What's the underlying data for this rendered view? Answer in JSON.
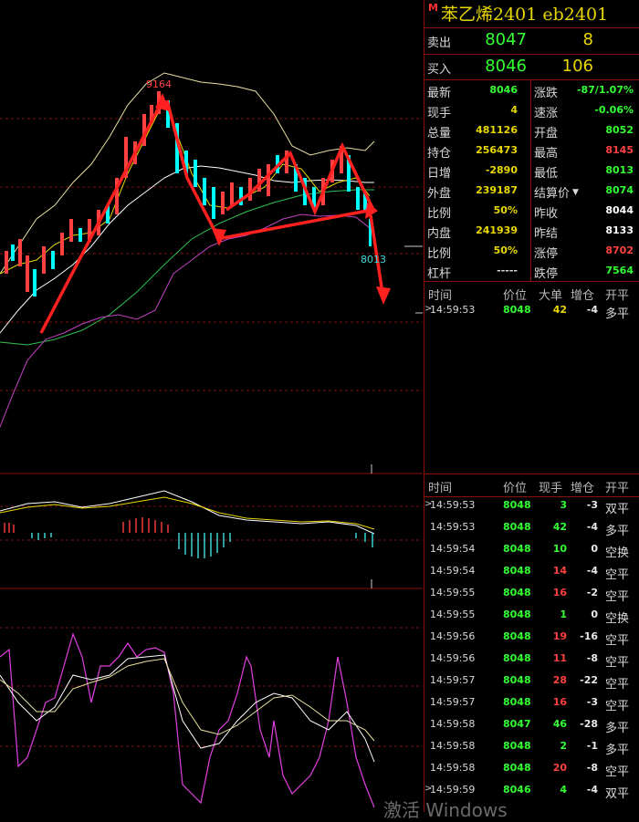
{
  "header": {
    "mark": "M",
    "title": "苯乙烯2401  eb2401"
  },
  "orderbook": {
    "ask": {
      "label": "卖出",
      "price": "8047",
      "volume": "8"
    },
    "bid": {
      "label": "买入",
      "price": "8046",
      "volume": "106"
    }
  },
  "stats_left": [
    {
      "label": "最新",
      "value": "8046",
      "color": "#33ff33"
    },
    {
      "label": "现手",
      "value": "4",
      "color": "#e8d800"
    },
    {
      "label": "总量",
      "value": "481126",
      "color": "#e8d800"
    },
    {
      "label": "持仓",
      "value": "256473",
      "color": "#e8d800"
    },
    {
      "label": "日增",
      "value": "-2890",
      "color": "#e8d800"
    },
    {
      "label": "外盘",
      "value": "239187",
      "color": "#e8d800"
    },
    {
      "label": "比例",
      "value": "50%",
      "color": "#e8d800"
    },
    {
      "label": "内盘",
      "value": "241939",
      "color": "#e8d800"
    },
    {
      "label": "比例",
      "value": "50%",
      "color": "#e8d800"
    },
    {
      "label": "杠杆",
      "value": "-----",
      "color": "#d8d8d8"
    }
  ],
  "stats_right": [
    {
      "label": "涨跌",
      "value": "-87/1.07%",
      "color": "#33ff33"
    },
    {
      "label": "速涨",
      "value": "-0.06%",
      "color": "#33ff33"
    },
    {
      "label": "开盘",
      "value": "8052",
      "color": "#33ff33"
    },
    {
      "label": "最高",
      "value": "8145",
      "color": "#ff4040"
    },
    {
      "label": "最低",
      "value": "8013",
      "color": "#33ff33"
    },
    {
      "label": "结算价",
      "value": "8074",
      "color": "#33ff33"
    },
    {
      "label": "昨收",
      "value": "8044",
      "color": "#ffffff"
    },
    {
      "label": "昨结",
      "value": "8133",
      "color": "#ffffff"
    },
    {
      "label": "涨停",
      "value": "8702",
      "color": "#ff4040"
    },
    {
      "label": "跌停",
      "value": "7564",
      "color": "#33ff33"
    }
  ],
  "big_orders": {
    "headers": [
      "时间",
      "价位",
      "大单",
      "增仓",
      "开平"
    ],
    "rows": [
      {
        "time": "14:59:53",
        "price": "8048",
        "vol": "42",
        "chg": "-4",
        "nature": "多平",
        "vol_color": "#e8d800"
      }
    ]
  },
  "ticks": {
    "headers": [
      "时间",
      "价位",
      "现手",
      "增仓",
      "开平"
    ],
    "rows": [
      {
        "time": "14:59:53",
        "price": "8048",
        "vol": "3",
        "chg": "-3",
        "nature": "双平",
        "vol_color": "#33ff33"
      },
      {
        "time": "14:59:53",
        "price": "8048",
        "vol": "42",
        "chg": "-4",
        "nature": "多平",
        "vol_color": "#33ff33"
      },
      {
        "time": "14:59:54",
        "price": "8048",
        "vol": "10",
        "chg": "0",
        "nature": "空换",
        "vol_color": "#33ff33"
      },
      {
        "time": "14:59:54",
        "price": "8048",
        "vol": "14",
        "chg": "-4",
        "nature": "空平",
        "vol_color": "#ff4040"
      },
      {
        "time": "14:59:55",
        "price": "8048",
        "vol": "16",
        "chg": "-2",
        "nature": "空平",
        "vol_color": "#ff4040"
      },
      {
        "time": "14:59:55",
        "price": "8048",
        "vol": "1",
        "chg": "0",
        "nature": "空换",
        "vol_color": "#33ff33"
      },
      {
        "time": "14:59:56",
        "price": "8048",
        "vol": "19",
        "chg": "-16",
        "nature": "空平",
        "vol_color": "#ff4040"
      },
      {
        "time": "14:59:56",
        "price": "8048",
        "vol": "11",
        "chg": "-8",
        "nature": "空平",
        "vol_color": "#ff4040"
      },
      {
        "time": "14:59:57",
        "price": "8048",
        "vol": "28",
        "chg": "-22",
        "nature": "空平",
        "vol_color": "#ff4040"
      },
      {
        "time": "14:59:57",
        "price": "8048",
        "vol": "16",
        "chg": "-3",
        "nature": "空平",
        "vol_color": "#ff4040"
      },
      {
        "time": "14:59:58",
        "price": "8047",
        "vol": "46",
        "chg": "-28",
        "nature": "多平",
        "vol_color": "#33ff33"
      },
      {
        "time": "14:59:58",
        "price": "8048",
        "vol": "2",
        "chg": "-1",
        "nature": "多平",
        "vol_color": "#33ff33"
      },
      {
        "time": "14:59:58",
        "price": "8048",
        "vol": "20",
        "chg": "-8",
        "nature": "空平",
        "vol_color": "#ff4040"
      },
      {
        "time": "14:59:59",
        "price": "8046",
        "vol": "4",
        "chg": "-4",
        "nature": "双平",
        "vol_color": "#33ff33"
      }
    ]
  },
  "chart": {
    "high_label": "9164",
    "low_label": "8013"
  },
  "watermark": "激活 Windows",
  "colors": {
    "up": "#ff4040",
    "down": "#33ff33",
    "border": "#8a1010",
    "accent": "#e8d800"
  }
}
